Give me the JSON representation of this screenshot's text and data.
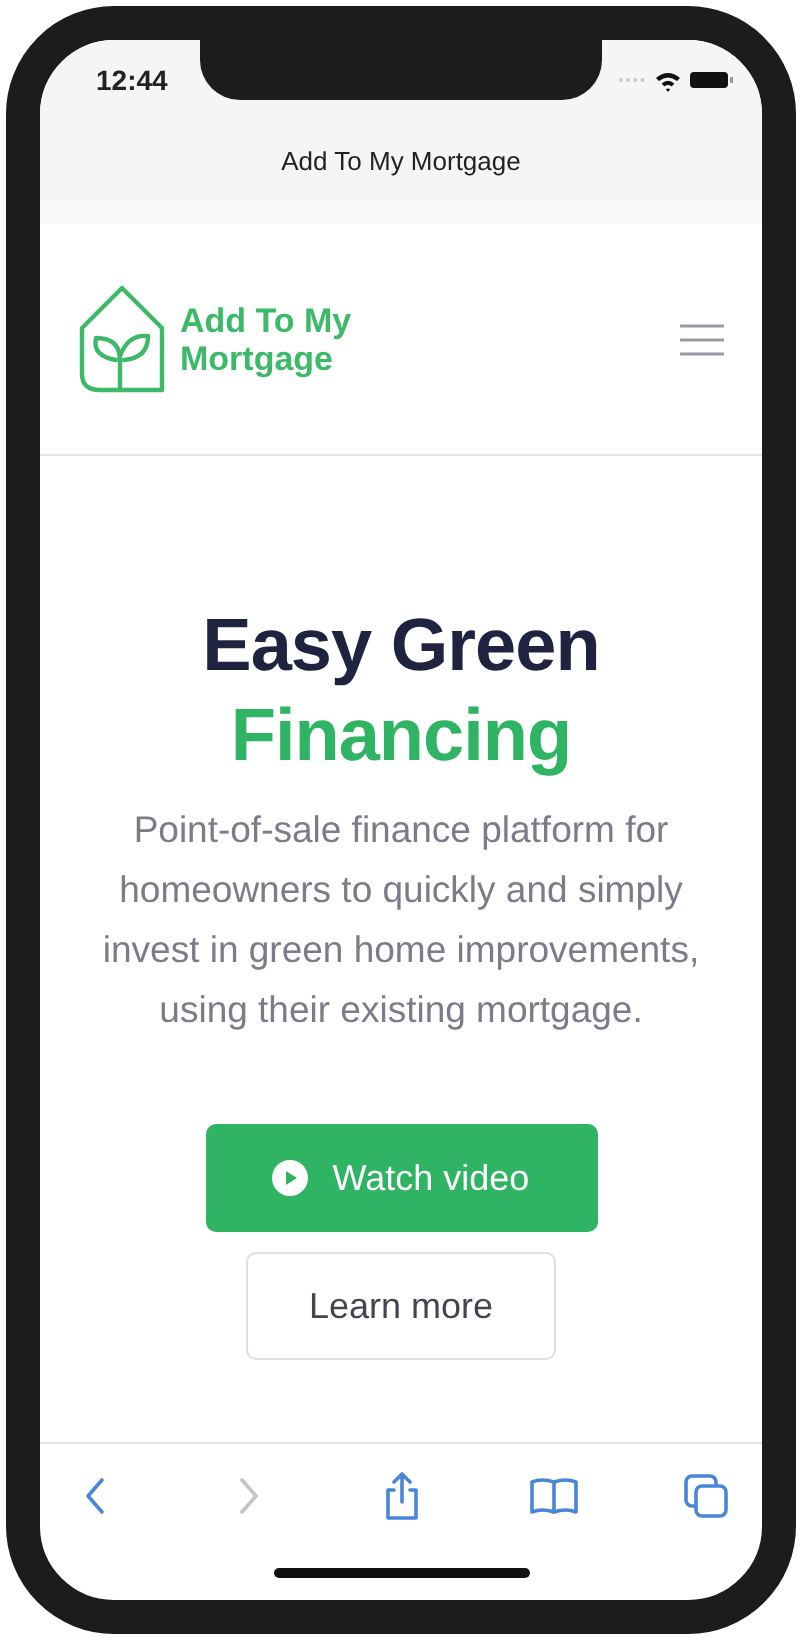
{
  "status_bar": {
    "time": "12:44"
  },
  "browser": {
    "page_title": "Add To My Mortgage"
  },
  "site_header": {
    "logo_lines": [
      "Add To My",
      "Mortgage"
    ]
  },
  "hero": {
    "title_line1": "Easy Green",
    "title_line2": "Financing",
    "description": "Point-of-sale finance platform for homeowners to quickly and simply invest in green home improvements, using their existing mortgage.",
    "buttons": [
      {
        "label": "Watch video",
        "kind": "primary"
      },
      {
        "label": "Learn more",
        "kind": "secondary"
      }
    ]
  },
  "toolbar": [
    {
      "kind": "back",
      "disabled": false
    },
    {
      "kind": "forward",
      "disabled": true
    },
    {
      "kind": "share",
      "disabled": false
    },
    {
      "kind": "bookmarks",
      "disabled": false
    },
    {
      "kind": "tabs",
      "disabled": false
    }
  ]
}
